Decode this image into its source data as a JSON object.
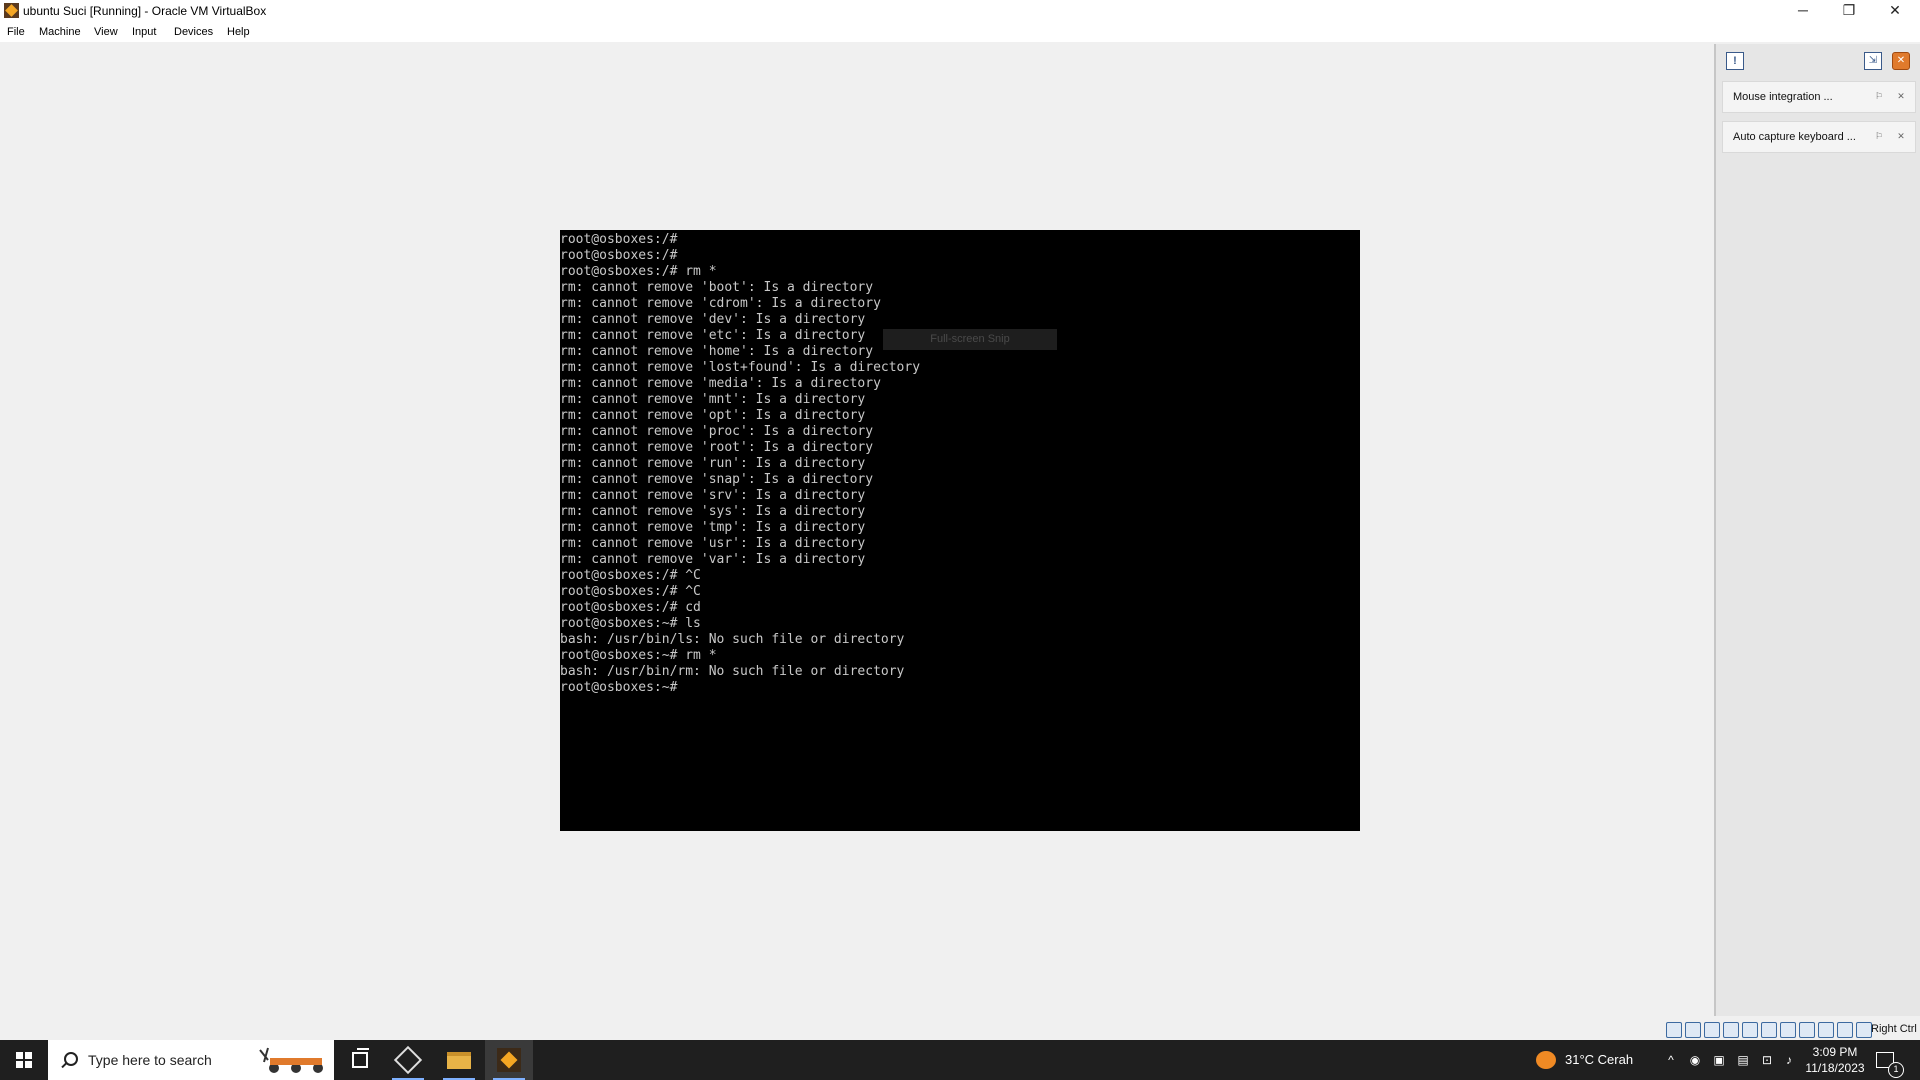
{
  "window": {
    "title": "ubuntu Suci [Running] - Oracle VM VirtualBox",
    "min_glyph": "─",
    "max_glyph": "❐",
    "close_glyph": "✕"
  },
  "menu": [
    "File",
    "Machine",
    "View",
    "Input",
    "Devices",
    "Help"
  ],
  "terminal": {
    "lines": [
      "root@osboxes:/#",
      "root@osboxes:/#",
      "root@osboxes:/# rm *",
      "rm: cannot remove 'boot': Is a directory",
      "rm: cannot remove 'cdrom': Is a directory",
      "rm: cannot remove 'dev': Is a directory",
      "rm: cannot remove 'etc': Is a directory",
      "rm: cannot remove 'home': Is a directory",
      "rm: cannot remove 'lost+found': Is a directory",
      "rm: cannot remove 'media': Is a directory",
      "rm: cannot remove 'mnt': Is a directory",
      "rm: cannot remove 'opt': Is a directory",
      "rm: cannot remove 'proc': Is a directory",
      "rm: cannot remove 'root': Is a directory",
      "rm: cannot remove 'run': Is a directory",
      "rm: cannot remove 'snap': Is a directory",
      "rm: cannot remove 'srv': Is a directory",
      "rm: cannot remove 'sys': Is a directory",
      "rm: cannot remove 'tmp': Is a directory",
      "rm: cannot remove 'usr': Is a directory",
      "rm: cannot remove 'var': Is a directory",
      "root@osboxes:/# ^C",
      "root@osboxes:/# ^C",
      "root@osboxes:/# cd",
      "root@osboxes:~# ls",
      "bash: /usr/bin/ls: No such file or directory",
      "root@osboxes:~# rm *",
      "bash: /usr/bin/rm: No such file or directory",
      "root@osboxes:~#"
    ],
    "snip_tooltip": "Full-screen Snip"
  },
  "notifications": {
    "items": [
      {
        "label": "Mouse integration ..."
      },
      {
        "label": "Auto capture keyboard ..."
      }
    ]
  },
  "status_bar": {
    "host_key": "Right Ctrl"
  },
  "taskbar": {
    "search_placeholder": "Type here to search",
    "weather": "31°C  Cerah",
    "time": "3:09 PM",
    "date": "11/18/2023",
    "notification_count": "1"
  },
  "colors": {
    "terminal_bg": "#000000",
    "terminal_fg": "#c8c8c8",
    "taskbar_bg": "#1f1f1f"
  }
}
